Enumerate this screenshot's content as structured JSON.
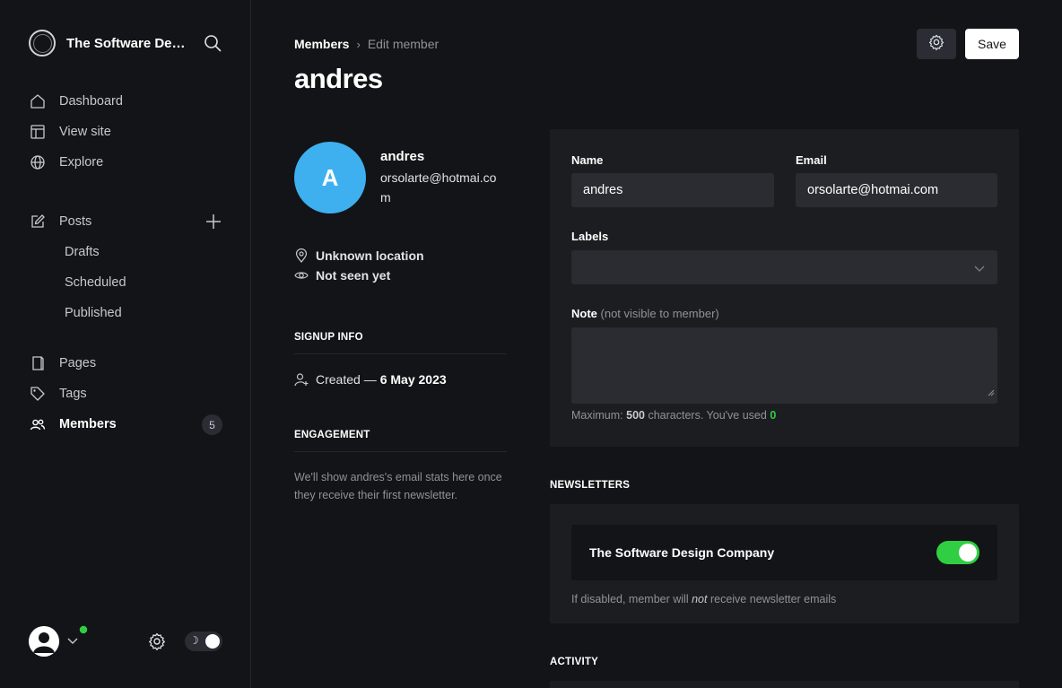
{
  "sidebar": {
    "brand": {
      "title": "The Software Design Company"
    },
    "nav": {
      "dashboard": "Dashboard",
      "view_site": "View site",
      "explore": "Explore",
      "posts": "Posts",
      "drafts": "Drafts",
      "scheduled": "Scheduled",
      "published": "Published",
      "pages": "Pages",
      "tags": "Tags",
      "members": "Members",
      "members_count": "5"
    },
    "footer": {
      "theme_icon": "☽"
    }
  },
  "header": {
    "breadcrumb_parent": "Members",
    "breadcrumb_sep": "›",
    "breadcrumb_current": "Edit member",
    "title": "andres",
    "save_label": "Save"
  },
  "profile": {
    "initial": "A",
    "name": "andres",
    "email": "orsolarte@hotmai.com",
    "location": "Unknown location",
    "seen": "Not seen yet",
    "signup_heading": "SIGNUP INFO",
    "created_prefix": "Created —",
    "created_date": "6 May 2023",
    "engagement_heading": "ENGAGEMENT",
    "engagement_text": "We'll show andres's email stats here once they receive their first newsletter."
  },
  "form": {
    "name_label": "Name",
    "name_value": "andres",
    "email_label": "Email",
    "email_value": "orsolarte@hotmai.com",
    "labels_label": "Labels",
    "note_label": "Note",
    "note_sublabel": "(not visible to member)",
    "note_hint_prefix": "Maximum:",
    "note_max": "500",
    "note_hint_mid": "characters. You've used",
    "note_used": "0"
  },
  "newsletters": {
    "heading": "NEWSLETTERS",
    "name": "The Software Design Company",
    "subscribed": true,
    "hint_prefix": "If disabled, member will",
    "hint_em": "not",
    "hint_suffix": "receive newsletter emails"
  },
  "activity": {
    "heading": "ACTIVITY"
  },
  "colors": {
    "background": "#131417",
    "card": "#1c1d21",
    "accent_green": "#30cf43",
    "avatar_blue": "#3eb0ef"
  }
}
